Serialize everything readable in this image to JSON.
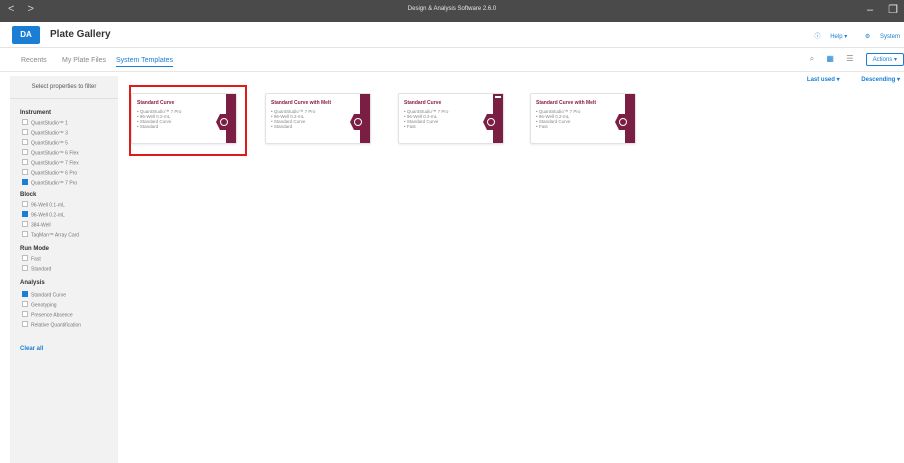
{
  "window": {
    "title": "Design & Analysis Software 2.6.0",
    "nav_back": "<",
    "nav_forward": ">"
  },
  "app": {
    "logo": "DA",
    "title": "Plate Gallery",
    "help": "Help",
    "system": "System"
  },
  "tabs": [
    "Recents",
    "My Plate Files",
    "System Templates"
  ],
  "toolbar": {
    "actions": "Actions"
  },
  "sort": {
    "primary": "Last used",
    "order": "Descending"
  },
  "sidebar": {
    "filter_title": "Select properties to filter",
    "sections": [
      {
        "name": "Instrument",
        "options": [
          {
            "label": "QuantStudio™ 1",
            "checked": false
          },
          {
            "label": "QuantStudio™ 3",
            "checked": false
          },
          {
            "label": "QuantStudio™ 5",
            "checked": false
          },
          {
            "label": "QuantStudio™ 6 Flex",
            "checked": false
          },
          {
            "label": "QuantStudio™ 7 Flex",
            "checked": false
          },
          {
            "label": "QuantStudio™ 6 Pro",
            "checked": false
          },
          {
            "label": "QuantStudio™ 7 Pro",
            "checked": true
          }
        ]
      },
      {
        "name": "Block",
        "options": [
          {
            "label": "96-Well 0.1-mL",
            "checked": false
          },
          {
            "label": "96-Well 0.2-mL",
            "checked": true
          },
          {
            "label": "384-Well",
            "checked": false
          },
          {
            "label": "TaqMan™ Array Card",
            "checked": false
          }
        ]
      },
      {
        "name": "Run Mode",
        "options": [
          {
            "label": "Fast",
            "checked": false
          },
          {
            "label": "Standard",
            "checked": false
          }
        ]
      },
      {
        "name": "Analysis",
        "options": [
          {
            "label": "Standard Curve",
            "checked": true
          },
          {
            "label": "Genotyping",
            "checked": false
          },
          {
            "label": "Presence Absence",
            "checked": false
          },
          {
            "label": "Relative Quantification",
            "checked": false
          }
        ]
      }
    ],
    "clear_all": "Clear all"
  },
  "cards": [
    {
      "title": "Standard Curve",
      "items": [
        "QuantStudio™ 7 Pro",
        "96-Well 0.2-mL",
        "Standard Curve",
        "Standard"
      ]
    },
    {
      "title": "Standard Curve with Melt",
      "items": [
        "QuantStudio™ 7 Pro",
        "96-Well 0.2-mL",
        "Standard Curve",
        "Standard"
      ]
    },
    {
      "title": "Standard Curve",
      "items": [
        "QuantStudio™ 7 Pro",
        "96-Well 0.2-mL",
        "Standard Curve",
        "Fast"
      ]
    },
    {
      "title": "Standard Curve with Melt",
      "items": [
        "QuantStudio™ 7 Pro",
        "96-Well 0.2-mL",
        "Standard Curve",
        "Fast"
      ]
    }
  ]
}
